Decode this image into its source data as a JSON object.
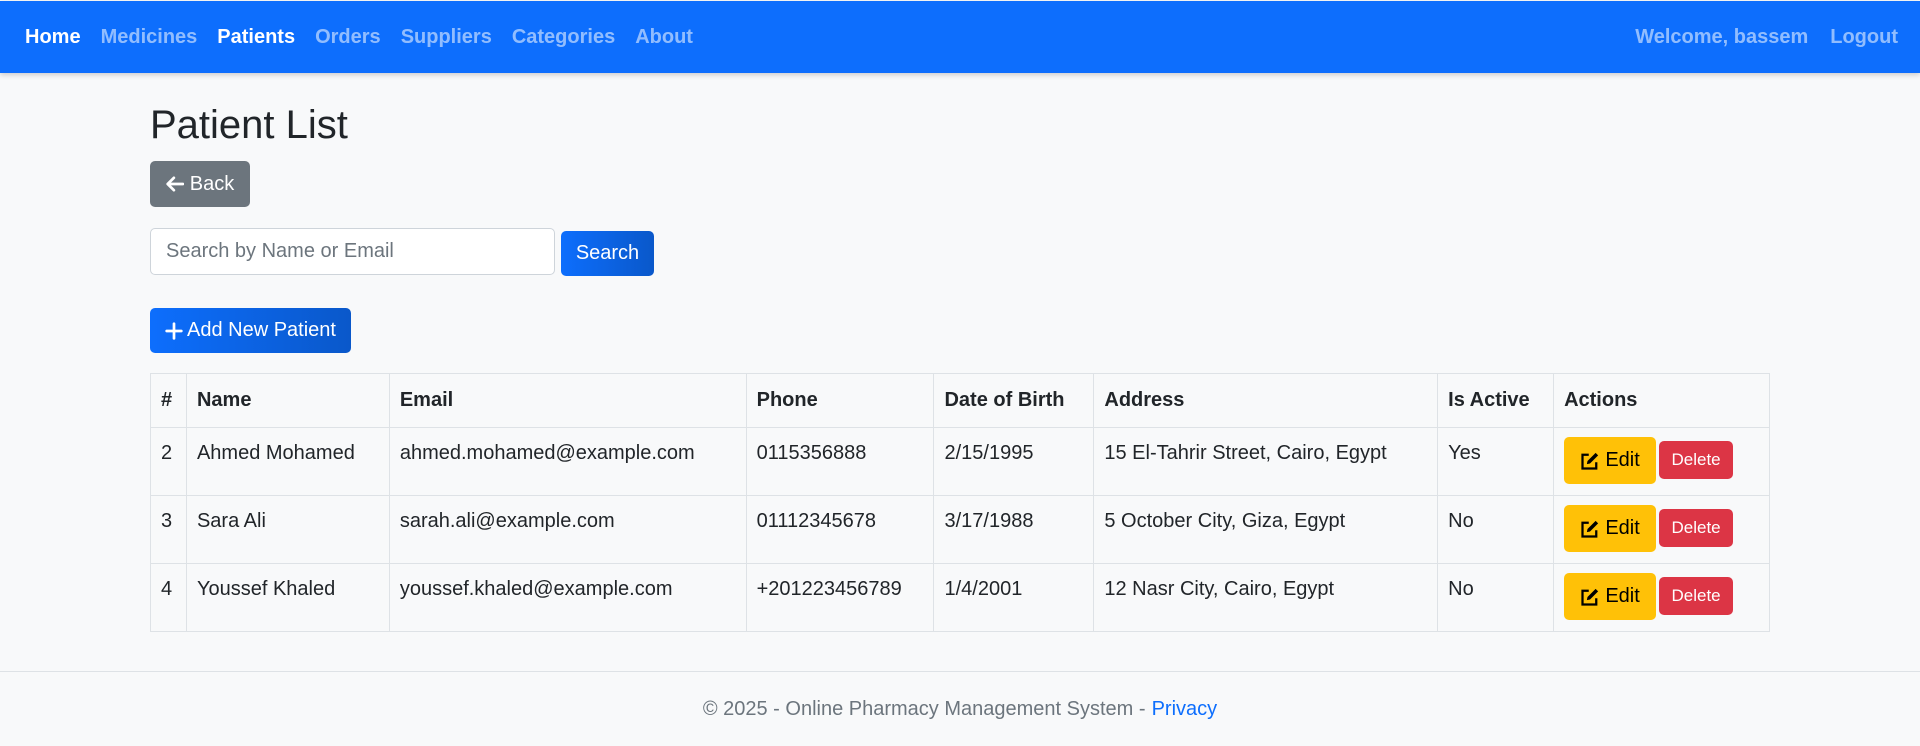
{
  "nav": {
    "links": [
      "Home",
      "Medicines",
      "Patients",
      "Orders",
      "Suppliers",
      "Categories",
      "About"
    ],
    "welcome": "Welcome, bassem",
    "logout": "Logout"
  },
  "page": {
    "title": "Patient List",
    "back_label": "Back",
    "search_placeholder": "Search by Name or Email",
    "search_label": "Search",
    "add_label": "Add New Patient"
  },
  "table": {
    "headers": [
      "#",
      "Name",
      "Email",
      "Phone",
      "Date of Birth",
      "Address",
      "Is Active",
      "Actions"
    ],
    "rows": [
      {
        "id": "2",
        "name": "Ahmed Mohamed",
        "email": "ahmed.mohamed@example.com",
        "phone": "0115356888",
        "dob": "2/15/1995",
        "address": "15 El-Tahrir Street, Cairo, Egypt",
        "active": "Yes"
      },
      {
        "id": "3",
        "name": "Sara Ali",
        "email": "sarah.ali@example.com",
        "phone": "01112345678",
        "dob": "3/17/1988",
        "address": "5 October City, Giza, Egypt",
        "active": "No"
      },
      {
        "id": "4",
        "name": "Youssef Khaled",
        "email": "youssef.khaled@example.com",
        "phone": "+201223456789",
        "dob": "1/4/2001",
        "address": "12 Nasr City, Cairo, Egypt",
        "active": "No"
      }
    ],
    "edit_label": "Edit",
    "delete_label": "Delete"
  },
  "footer": {
    "text": "© 2025 - Online Pharmacy Management System -",
    "privacy": "Privacy"
  },
  "colors": {
    "primary": "#0d6efd",
    "secondary": "#6c757d",
    "warning": "#ffc107",
    "danger": "#dc3545"
  }
}
